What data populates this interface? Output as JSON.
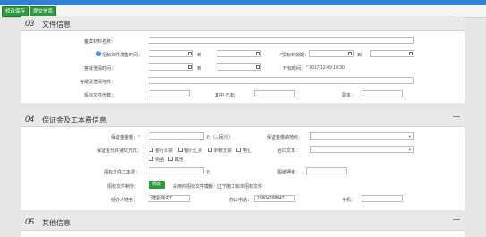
{
  "toolbar": {
    "save_draft": "修改保存",
    "submit": "提交信息"
  },
  "sec03": {
    "num": "03",
    "title": "文件信息",
    "record_label": "备案材料名称：",
    "sale_time_label": "招标文件发售时间：",
    "to": "到",
    "valid_period_label": "投标有效期：",
    "answer_time_label": "答疑澄清时间：",
    "open_time_label": "开标时间：",
    "open_time_value": "2017-12-09 10:30",
    "answer_place_label": "答疑及澄清地点：",
    "copies_label": "投标文件份数：",
    "original_label": "其中 正本：",
    "duplicate_label": "副本："
  },
  "sec04": {
    "num": "04",
    "title": "保证金及工本费信息",
    "deposit_amount_label": "保证金金额：",
    "deposit_unit": "元（人民币）",
    "deposit_method_label": "保证金缴纳地点：",
    "pay_methods_label": "保证金允许递交方式：",
    "methods": [
      "银行本票",
      "银行汇票",
      "转帐支票",
      "电汇",
      "保函",
      "其他"
    ],
    "contract_label": "合同文本：",
    "cost_label": "招标文件工本费：",
    "cost_unit": "元",
    "drawing_deposit_label": "图纸押金：",
    "template_label": "招标文件制作：",
    "edit_btn": "修改",
    "template_text": "采用的招标文件模板：辽宁施工标准招标文件",
    "handler_label": "经办人姓名：",
    "handler_value": "建委测试7",
    "phone_label": "办公电话：",
    "phone_value": "15804298847",
    "mobile_label": "手机："
  },
  "sec05": {
    "num": "05",
    "title": "其他信息"
  },
  "colors": {
    "topbar": "#2f80d6",
    "button_green": "#2e9a3e",
    "required": "#e53935"
  }
}
